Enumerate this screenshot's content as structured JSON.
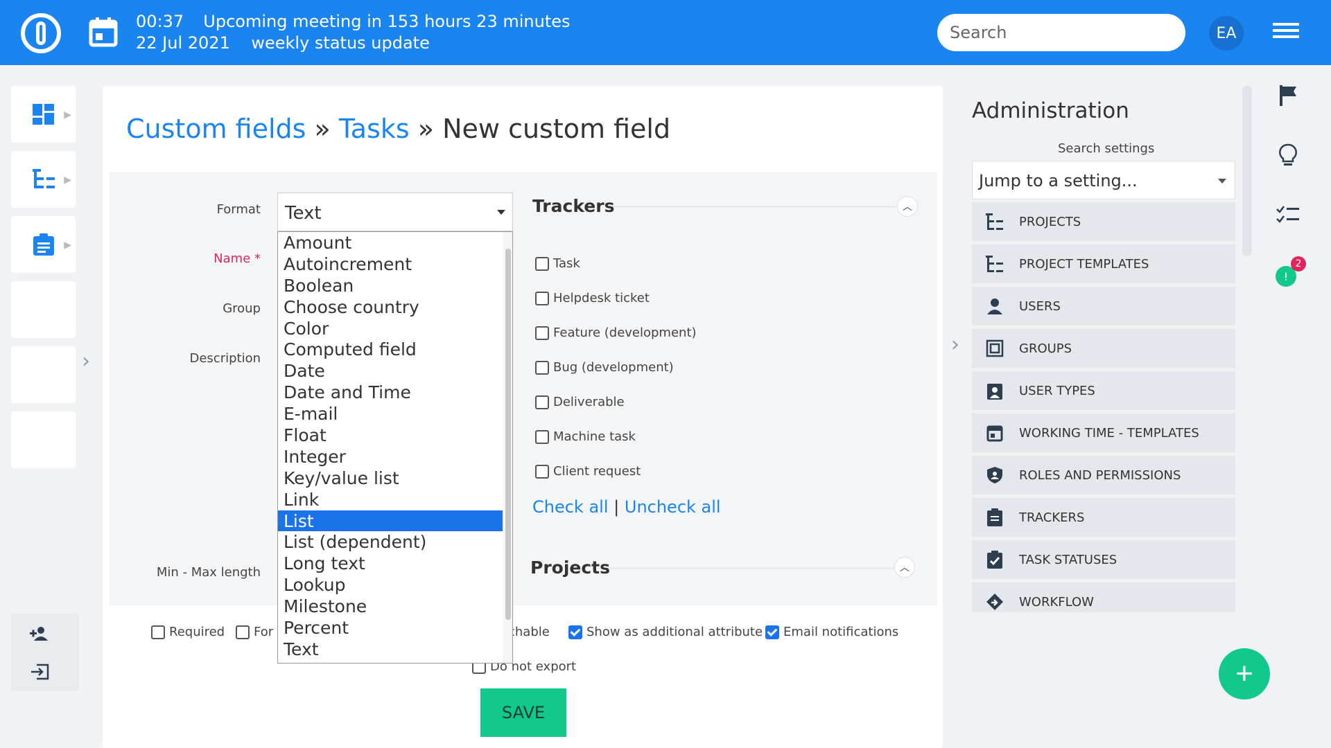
{
  "topbar": {
    "meeting_time": "00:37",
    "meeting_text": "Upcoming meeting in 153 hours 23 minutes",
    "meeting_date": "22 Jul 2021",
    "meeting_title": "weekly status update",
    "search_placeholder": "Search",
    "avatar_initials": "EA"
  },
  "breadcrumb": {
    "part1": "Custom fields",
    "sep1": " » ",
    "part2": "Tasks",
    "sep2": " » ",
    "current": "New custom field"
  },
  "form": {
    "format_label": "Format",
    "format_value": "Text",
    "name_label": "Name *",
    "group_label": "Group",
    "description_label": "Description",
    "minmax_label": "Min - Max length",
    "format_options": [
      "Amount",
      "Autoincrement",
      "Boolean",
      "Choose country",
      "Color",
      "Computed field",
      "Date",
      "Date and Time",
      "E-mail",
      "Float",
      "Integer",
      "Key/value list",
      "Link",
      "List",
      "List (dependent)",
      "Long text",
      "Lookup",
      "Milestone",
      "Percent",
      "Text"
    ],
    "selected_option": "List"
  },
  "trackers": {
    "title": "Trackers",
    "items": [
      "Task",
      "Helpdesk ticket",
      "Feature (development)",
      "Bug (development)",
      "Deliverable",
      "Machine task",
      "Client request"
    ],
    "check_all": "Check all",
    "sep": "|",
    "uncheck_all": "Uncheck all"
  },
  "projects": {
    "title": "Projects"
  },
  "bottom_options": {
    "required": "Required",
    "for": "For",
    "searchable": "rchable",
    "show_additional": "Show as additional attribute",
    "email_notifications": "Email notifications",
    "do_not_export": "Do not export"
  },
  "save_label": "SAVE",
  "admin": {
    "title": "Administration",
    "search_label": "Search settings",
    "jump_placeholder": "Jump to a setting...",
    "items": [
      "PROJECTS",
      "PROJECT TEMPLATES",
      "USERS",
      "GROUPS",
      "USER TYPES",
      "WORKING TIME - TEMPLATES",
      "ROLES AND PERMISSIONS",
      "TRACKERS",
      "TASK STATUSES",
      "WORKFLOW"
    ]
  },
  "notifications": {
    "badge_count": "2",
    "badge_dot": "!"
  },
  "fab_label": "+",
  "colors": {
    "brand": "#1a84f0",
    "accent_green": "#12c98c",
    "selection": "#1a73e8"
  }
}
